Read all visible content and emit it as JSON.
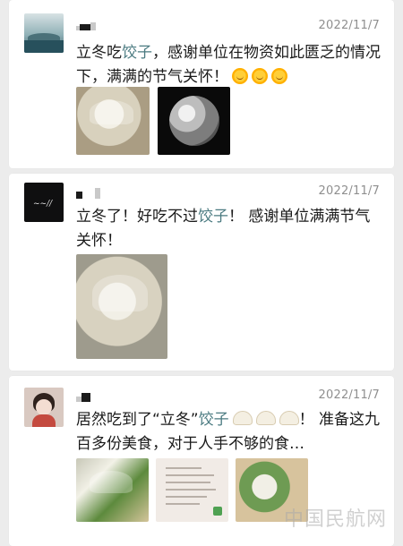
{
  "posts": [
    {
      "time": "2022/11/7",
      "text_pre": "立冬吃",
      "text_hl": "饺子",
      "text_post": "，感谢单位在物资如此匮乏的情况下，满满的节气关怀！",
      "emojis": [
        "sun-emoji",
        "sun-emoji",
        "sun-emoji"
      ],
      "images": [
        "dumplings-photo",
        "moon-photo"
      ]
    },
    {
      "time": "2022/11/7",
      "text_pre": "立冬了！好吃不过",
      "text_hl": "饺子",
      "text_post": "！ 感谢单位满满节气关怀！",
      "images": [
        "dumplings-photo"
      ]
    },
    {
      "time": "2022/11/7",
      "text_pre": "居然吃到了“立冬”",
      "text_hl": "饺子",
      "text_post": "！ 准备这九百多份美食，对于人手不够的食…",
      "emojis": [
        "dumpling-emoji",
        "dumpling-emoji",
        "dumpling-emoji"
      ],
      "images": [
        "dumplings-vegetables-photo",
        "notice-photo",
        "dumplings-photo"
      ]
    }
  ],
  "watermark": "中国民航网"
}
